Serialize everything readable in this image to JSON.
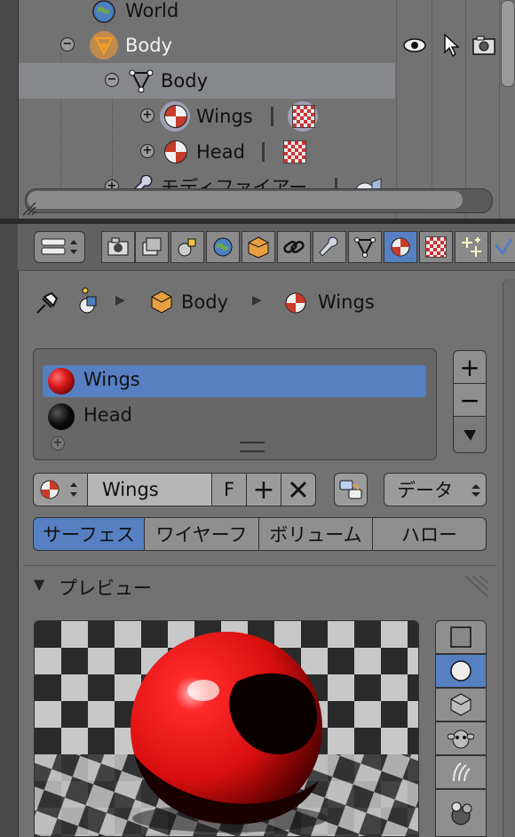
{
  "outliner": {
    "rows": [
      {
        "label": "World"
      },
      {
        "label": "Body"
      },
      {
        "label": "Body"
      },
      {
        "label": "Wings"
      },
      {
        "label": "Head"
      },
      {
        "label": "モディファイアー"
      }
    ]
  },
  "properties": {
    "breadcrumb": {
      "object": "Body",
      "material": "Wings"
    },
    "material_slots": [
      {
        "name": "Wings",
        "selected": true,
        "color": "#d81818"
      },
      {
        "name": "Head",
        "selected": false,
        "color": "#0a0a0a"
      }
    ],
    "material_field": {
      "name": "Wings",
      "fake_user": "F"
    },
    "link_dropdown": "データ",
    "surface_tabs": [
      "サーフェス",
      "ワイヤーフ",
      "ボリューム",
      "ハロー"
    ],
    "active_surface_tab": "サーフェス",
    "preview_panel": {
      "title": "プレビュー"
    }
  },
  "colors": {
    "active_blue": "#5680c2",
    "material_red": "#d81818"
  }
}
